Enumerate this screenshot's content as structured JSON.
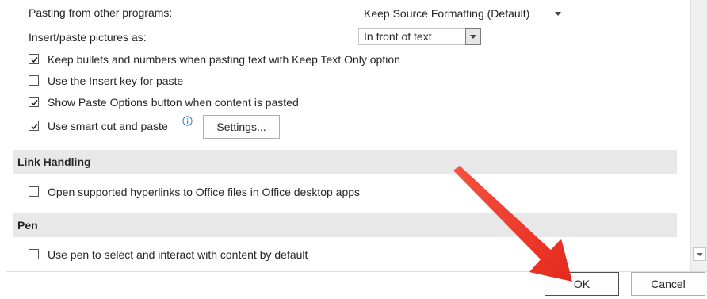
{
  "paste_options": {
    "pasting_from_label": "Pasting from other programs:",
    "pasting_from_value": "Keep Source Formatting (Default)",
    "insert_pictures_label": "Insert/paste pictures as:",
    "insert_pictures_value": "In front of text"
  },
  "checkboxes": [
    {
      "label": "Keep bullets and numbers when pasting text with Keep Text Only option",
      "checked": true
    },
    {
      "label": "Use the Insert key for paste",
      "checked": false
    },
    {
      "label": "Show Paste Options button when content is pasted",
      "checked": true
    },
    {
      "label": "Use smart cut and paste",
      "checked": true
    }
  ],
  "settings_button": "Settings...",
  "link_handling": {
    "title": "Link Handling",
    "option_label": "Open supported hyperlinks to Office files in Office desktop apps",
    "checked": false
  },
  "pen": {
    "title": "Pen",
    "option_label": "Use pen to select and interact with content by default",
    "checked": false
  },
  "footer": {
    "ok_label": "OK",
    "cancel_label": "Cancel"
  },
  "colors": {
    "annotation_arrow": "#f03a2e",
    "section_header": "#e8e8e8"
  }
}
